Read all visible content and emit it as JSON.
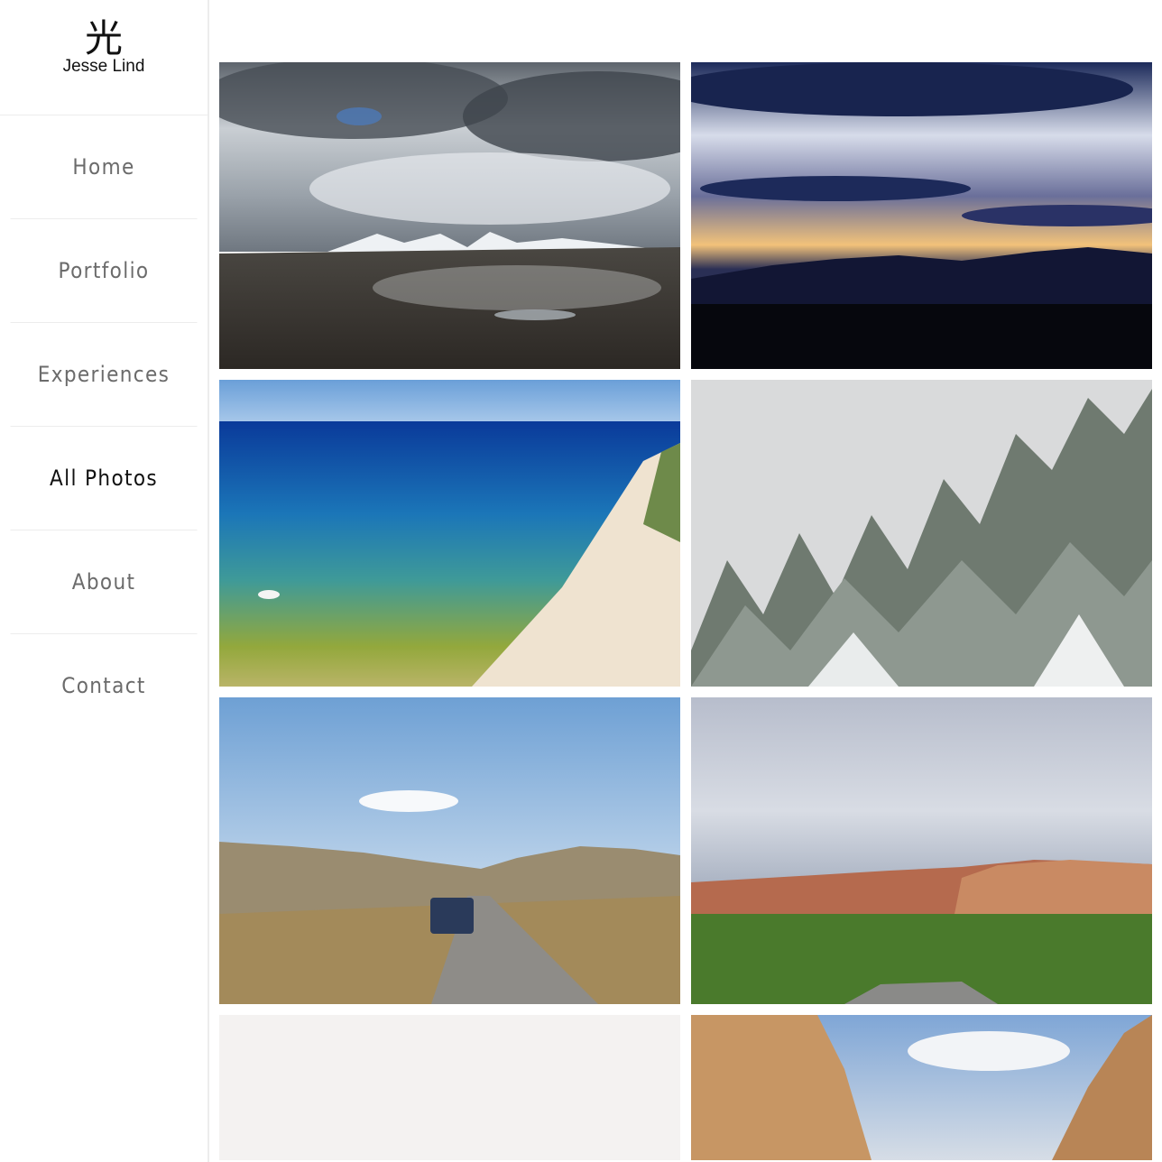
{
  "site": {
    "logo_glyph": "光",
    "logo_name": "Jesse Lind"
  },
  "nav": {
    "items": [
      {
        "label": "Home"
      },
      {
        "label": "Portfolio"
      },
      {
        "label": "Experiences"
      },
      {
        "label": "All Photos",
        "active": true
      },
      {
        "label": "About"
      },
      {
        "label": "Contact"
      }
    ]
  },
  "gallery": {
    "photos": [
      {
        "subject": "stormy clouds over snowy mountain valley"
      },
      {
        "subject": "sunset over dark mountain silhouette"
      },
      {
        "subject": "aerial view of turquoise lake shore and sandy beach"
      },
      {
        "subject": "snow covered pine forest in fog"
      },
      {
        "subject": "car driving on desert road between hills"
      },
      {
        "subject": "red rock canyon cliffs with green trees"
      },
      {
        "subject": "overexposed bright sky"
      },
      {
        "subject": "sandstone canyon walls and cloudy sky"
      }
    ]
  }
}
